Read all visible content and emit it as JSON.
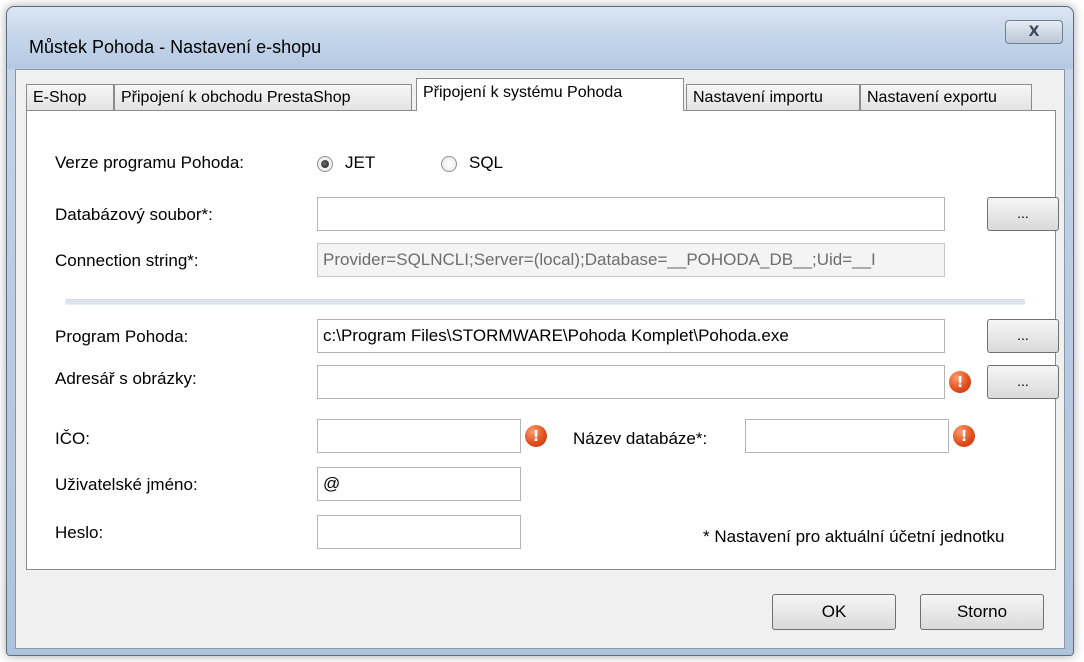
{
  "window": {
    "title": "Můstek Pohoda - Nastavení e-shopu",
    "close_glyph": "X"
  },
  "tabs": [
    {
      "label": "E-Shop",
      "active": false
    },
    {
      "label": "Připojení k obchodu PrestaShop",
      "active": false
    },
    {
      "label": "Připojení k systému Pohoda",
      "active": true
    },
    {
      "label": "Nastavení importu",
      "active": false
    },
    {
      "label": "Nastavení exportu",
      "active": false
    }
  ],
  "form": {
    "version_label": "Verze programu Pohoda:",
    "version_options": [
      {
        "label": "JET",
        "checked": true
      },
      {
        "label": "SQL",
        "checked": false
      }
    ],
    "db_file_label": "Databázový soubor*:",
    "db_file_value": "",
    "db_file_browse": "...",
    "conn_string_label": "Connection string*:",
    "conn_string_value": "Provider=SQLNCLI;Server=(local);Database=__POHODA_DB__;Uid=__I",
    "program_label": "Program Pohoda:",
    "program_value": "c:\\Program Files\\STORMWARE\\Pohoda Komplet\\Pohoda.exe",
    "program_browse": "...",
    "images_label": "Adresář s obrázky:",
    "images_value": "",
    "images_browse": "...",
    "ico_label": "IČO:",
    "ico_value": "",
    "dbname_label": "Název databáze*:",
    "dbname_value": "",
    "username_label": "Uživatelské jméno:",
    "username_value": "@",
    "password_label": "Heslo:",
    "password_value": "",
    "note": "* Nastavení pro aktuální účetní jednotku",
    "error_glyph": "!"
  },
  "footer": {
    "ok_label": "OK",
    "cancel_label": "Storno"
  },
  "colors": {
    "error_icon": "#e2501f",
    "title_bar": "#c6d6ea"
  }
}
